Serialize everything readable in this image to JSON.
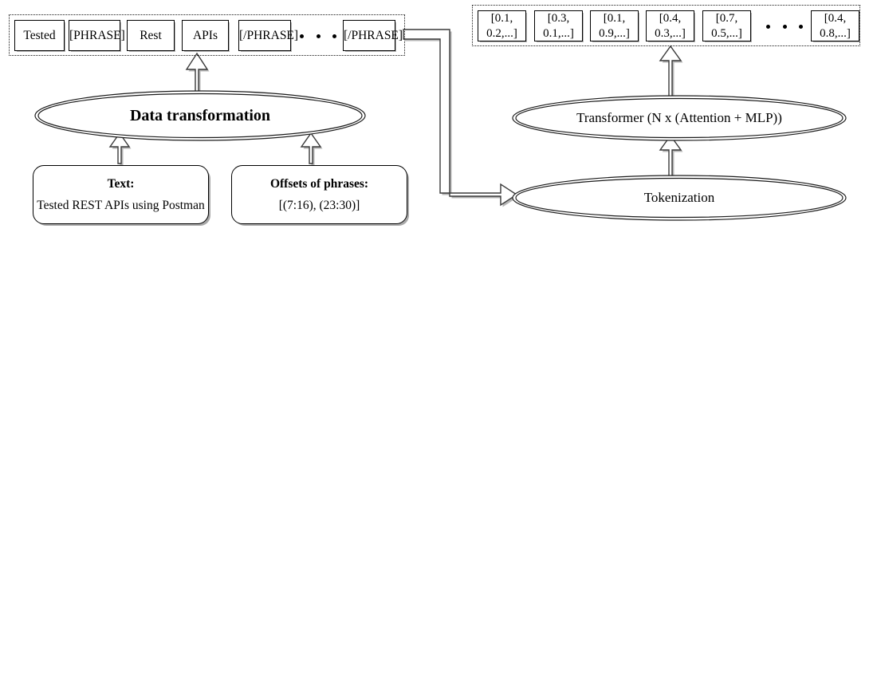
{
  "diagram": {
    "title": "Data transformation pipeline",
    "colors": {
      "stroke": "#000000",
      "arrow_stroke": "#3a3a3a",
      "arrow_fill": "#ffffff",
      "background": "#ffffff",
      "dotted_border": "#1a1a1a"
    }
  },
  "left_branch": {
    "token_row": {
      "name": "tagged token sequence",
      "tokens": [
        {
          "label": "Tested"
        },
        {
          "label": "[PHRASE]"
        },
        {
          "label": "Rest"
        },
        {
          "label": "APIs"
        },
        {
          "label": "[/PHRASE]"
        },
        {
          "label": "[/PHRASE]"
        }
      ],
      "ellipsis": "• • •"
    },
    "process": {
      "label": "Data transformation"
    },
    "inputs": [
      {
        "header": "Text:",
        "body": "Tested REST APIs using Postman"
      },
      {
        "header": "Offsets of phrases:",
        "body": "[(7:16), (23:30)]"
      }
    ]
  },
  "right_branch": {
    "embedding_row": {
      "name": "embedding vectors",
      "vectors": [
        {
          "label": "[0.1,\n0.2,...]"
        },
        {
          "label": "[0.3,\n0.1,...]"
        },
        {
          "label": "[0.1,\n0.9,...]"
        },
        {
          "label": "[0.4,\n0.3,...]"
        },
        {
          "label": "[0.7,\n0.5,...]"
        },
        {
          "label": "[0.4,\n0.8,...]"
        }
      ],
      "ellipsis": "• • •"
    },
    "transformer": {
      "label": "Transformer (N x (Attention + MLP))"
    },
    "tokenization": {
      "label": "Tokenization"
    }
  }
}
